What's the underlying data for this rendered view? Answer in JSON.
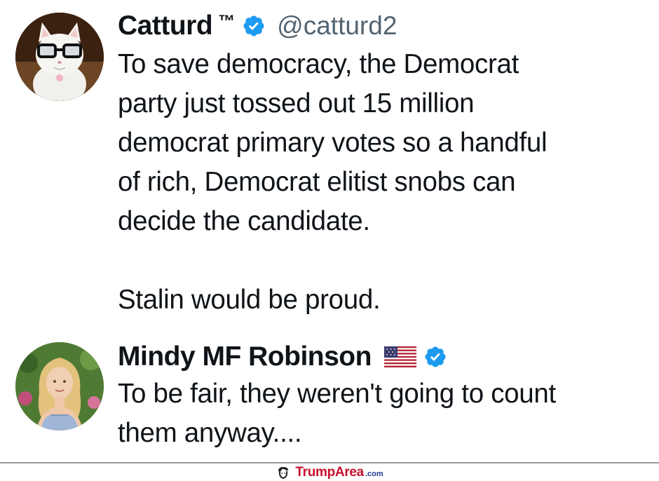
{
  "tweets": [
    {
      "name": "Catturd",
      "name_suffix": "™",
      "handle": "@catturd2",
      "text": "To save democracy, the Democrat\nparty just tossed out 15 million\ndemocrat primary votes so a handful\nof rich, Democrat elitist snobs can\ndecide the candidate.\n\nStalin would be proud.",
      "verified": true,
      "avatar_icon": "cat-with-glasses-avatar"
    },
    {
      "name": "Mindy MF Robinson",
      "name_flag_icon": "us-flag-icon",
      "text": "To be fair, they weren't going to count\nthem anyway....",
      "verified": true,
      "avatar_icon": "woman-blonde-avatar"
    }
  ],
  "footer": {
    "brand_main": "TrumpArea",
    "brand_suffix": ".com",
    "logo_icon": "trump-silhouette-icon"
  },
  "colors": {
    "text": "#0f1419",
    "handle": "#536471",
    "verified": "#1d9bf0",
    "brand_red": "#c8102e",
    "brand_blue": "#1f3a93"
  }
}
